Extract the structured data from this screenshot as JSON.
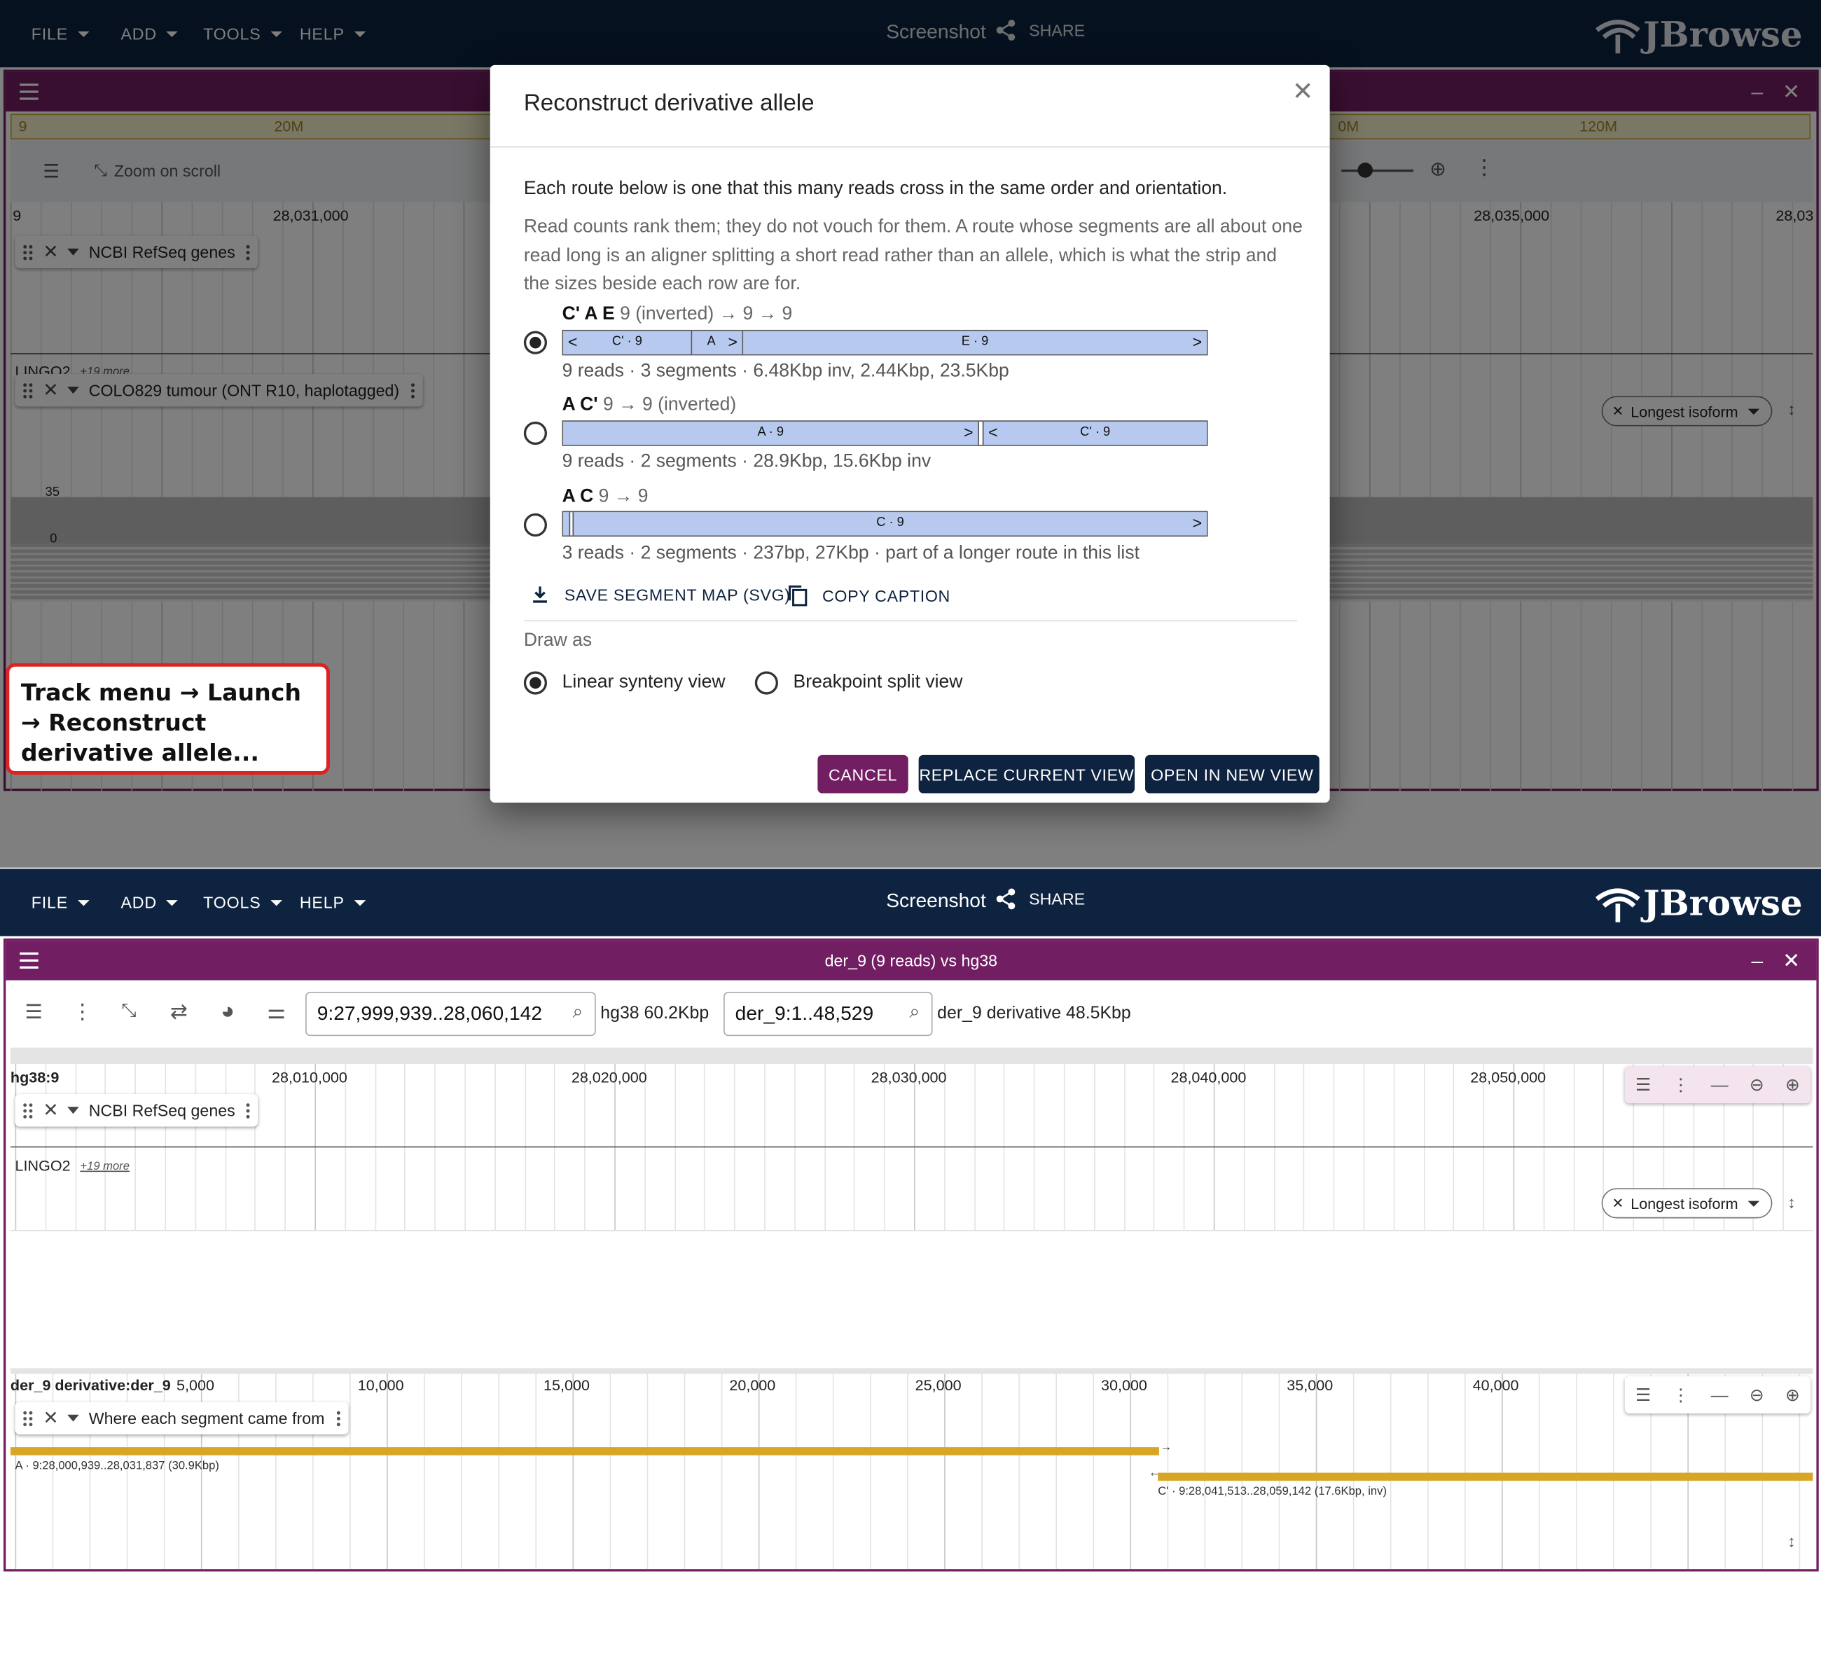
{
  "top_app": {
    "menus": [
      "FILE",
      "ADD",
      "TOOLS",
      "HELP"
    ],
    "screenshot_label": "Screenshot",
    "share_label": "SHARE",
    "brand": "JBrowse"
  },
  "top_view": {
    "overview_labels": [
      "9",
      "20M",
      "0M",
      "120M"
    ],
    "zoom_on_scroll": "Zoom on scroll",
    "ruler_chrom": "9",
    "ruler_ticks": [
      "28,031,000",
      "28,035,000",
      "28,03"
    ],
    "gene_track_name": "NCBI RefSeq genes",
    "gene_label": "LINGO2",
    "more_label": "+19 more",
    "isoform_label": "Longest isoform",
    "reads_track_name": "COLO829 tumour (ONT R10, haplotagged)",
    "coverage_max": "35",
    "coverage_min": "0"
  },
  "callout": {
    "text": "Track menu → Launch → Reconstruct derivative allele..."
  },
  "dialog": {
    "title": "Reconstruct derivative allele",
    "intro_line": "Each route below is one that this many reads cross in the same order and orientation.",
    "intro_note": "Read counts rank them; they do not vouch for them. A route whose segments are all about one read long is an aligner splitting a short read rather than an allele, which is what the strip and the sizes beside each row are for.",
    "routes": [
      {
        "letters": "C' A E",
        "path": "9 (inverted) → 9 → 9",
        "meta": "9 reads · 3 segments · 6.48Kbp inv, 2.44Kbp, 23.5Kbp",
        "segments": [
          {
            "label": "C' · 9",
            "arrow": "<"
          },
          {
            "label": "A",
            "arrow": ">"
          },
          {
            "label": "E · 9",
            "arrow": ">"
          }
        ]
      },
      {
        "letters": "A C'",
        "path": "9 → 9 (inverted)",
        "meta": "9 reads · 2 segments · 28.9Kbp, 15.6Kbp inv",
        "segments": [
          {
            "label": "A · 9",
            "arrow": ">"
          },
          {
            "label": "C' · 9",
            "arrow": "<"
          }
        ]
      },
      {
        "letters": "A C",
        "path": "9 → 9",
        "meta": "3 reads · 2 segments · 237bp, 27Kbp · part of a longer route in this list",
        "segments": [
          {
            "label": "",
            "arrow": ""
          },
          {
            "label": "C · 9",
            "arrow": ">"
          }
        ]
      }
    ],
    "save_svg": "SAVE SEGMENT MAP (SVG)",
    "copy_caption": "COPY CAPTION",
    "draw_as": "Draw as",
    "options": [
      "Linear synteny view",
      "Breakpoint split view"
    ],
    "cancel": "CANCEL",
    "replace": "REPLACE CURRENT VIEW",
    "open_new": "OPEN IN NEW VIEW"
  },
  "bottom_view": {
    "title": "der_9 (9 reads) vs hg38",
    "loc1": "9:27,999,939..28,060,142",
    "loc1_note": "hg38 60.2Kbp",
    "loc2": "der_9:1..48,529",
    "loc2_note": "der_9 derivative 48.5Kbp",
    "ruler1_chrom": "hg38:9",
    "ruler1_ticks": [
      "28,010,000",
      "28,020,000",
      "28,030,000",
      "28,040,000",
      "28,050,000"
    ],
    "gene_track_name": "NCBI RefSeq genes",
    "gene_label": "LINGO2",
    "more_label": "+19 more",
    "isoform_label": "Longest isoform",
    "ruler2_chrom": "der_9 derivative:der_9",
    "ruler2_ticks": [
      "5,000",
      "10,000",
      "15,000",
      "20,000",
      "25,000",
      "30,000",
      "35,000",
      "40,000"
    ],
    "segment_track_name": "Where each segment came from",
    "feature_a": "A · 9:28,000,939..28,031,837 (30.9Kbp)",
    "feature_c": "C' · 9:28,041,513..28,059,142 (17.6Kbp, inv)"
  },
  "colors": {
    "appbar": "#0d233f",
    "panel": "#721e63",
    "segment": "#b7c9ef",
    "feature": "#d8a627",
    "callout_border": "#dd2222"
  }
}
